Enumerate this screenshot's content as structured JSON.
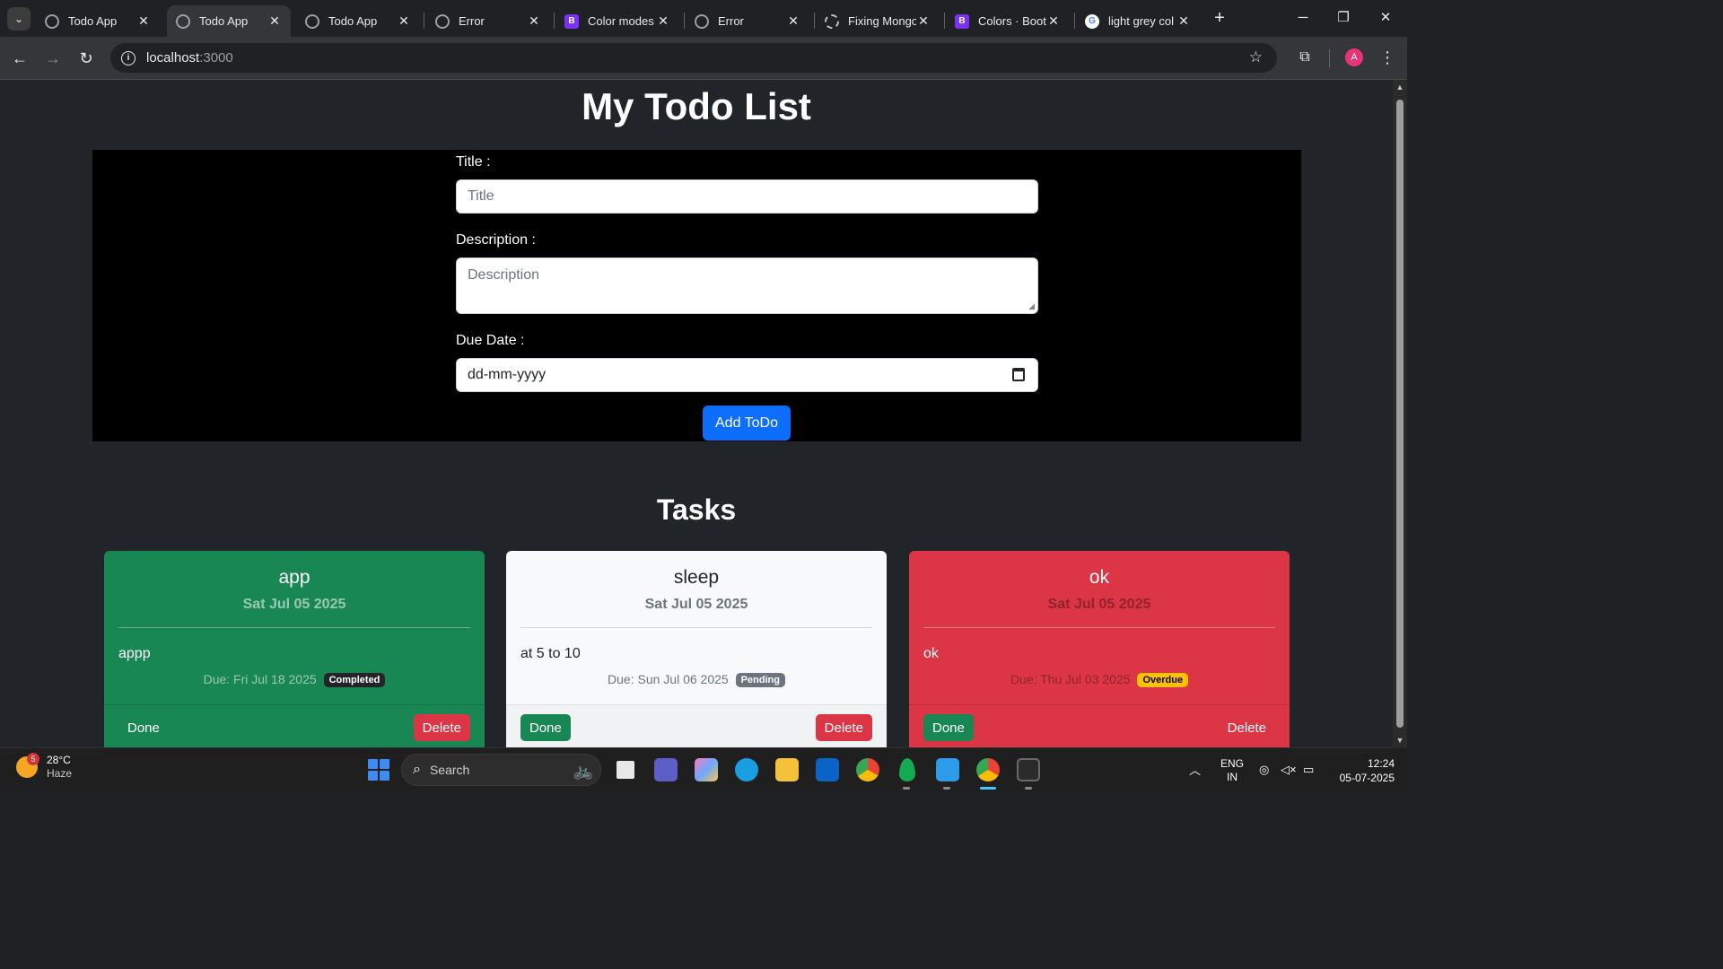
{
  "browser": {
    "tabs": [
      {
        "label": "Todo App",
        "icon": "globe-icon",
        "active": false
      },
      {
        "label": "Todo App",
        "icon": "globe-icon",
        "active": true
      },
      {
        "label": "Todo App",
        "icon": "globe-icon",
        "active": false
      },
      {
        "label": "Error",
        "icon": "globe-icon",
        "active": false
      },
      {
        "label": "Color modes",
        "icon": "bootstrap-icon",
        "active": false
      },
      {
        "label": "Error",
        "icon": "globe-icon",
        "active": false
      },
      {
        "label": "Fixing Mongo",
        "icon": "chatgpt-icon",
        "active": false
      },
      {
        "label": "Colors · Boots",
        "icon": "bootstrap-icon",
        "active": false
      },
      {
        "label": "light grey col",
        "icon": "google-icon",
        "active": false
      }
    ],
    "url_host": "localhost",
    "url_port": ":3000",
    "profile_initial": "A"
  },
  "page": {
    "title": "My Todo List",
    "form": {
      "title_label": "Title :",
      "title_placeholder": "Title",
      "description_label": "Description :",
      "description_placeholder": "Description",
      "due_label": "Due Date :",
      "due_placeholder": "dd-mm-yyyy",
      "add_button": "Add ToDo"
    },
    "tasks_heading": "Tasks",
    "tasks": [
      {
        "title": "app",
        "date": "Sat Jul 05 2025",
        "description": "appp",
        "due": "Due: Fri Jul 18 2025",
        "status": "Completed",
        "theme": "green",
        "done_label": "Done",
        "delete_label": "Delete"
      },
      {
        "title": "sleep",
        "date": "Sat Jul 05 2025",
        "description": "at 5 to 10",
        "due": "Due: Sun Jul 06 2025",
        "status": "Pending",
        "theme": "light",
        "done_label": "Done",
        "delete_label": "Delete"
      },
      {
        "title": "ok",
        "date": "Sat Jul 05 2025",
        "description": "ok",
        "due": "Due: Thu Jul 03 2025",
        "status": "Overdue",
        "theme": "red",
        "done_label": "Done",
        "delete_label": "Delete"
      }
    ]
  },
  "colors": {
    "primary": "#0d6efd",
    "success": "#198754",
    "danger": "#dc3545",
    "warning": "#ffc107",
    "page_bg": "#212529"
  },
  "taskbar": {
    "weather_badge": "5",
    "temperature": "28°C",
    "condition": "Haze",
    "search_label": "Search",
    "lang_top": "ENG",
    "lang_bottom": "IN",
    "time": "12:24",
    "date": "05-07-2025"
  }
}
